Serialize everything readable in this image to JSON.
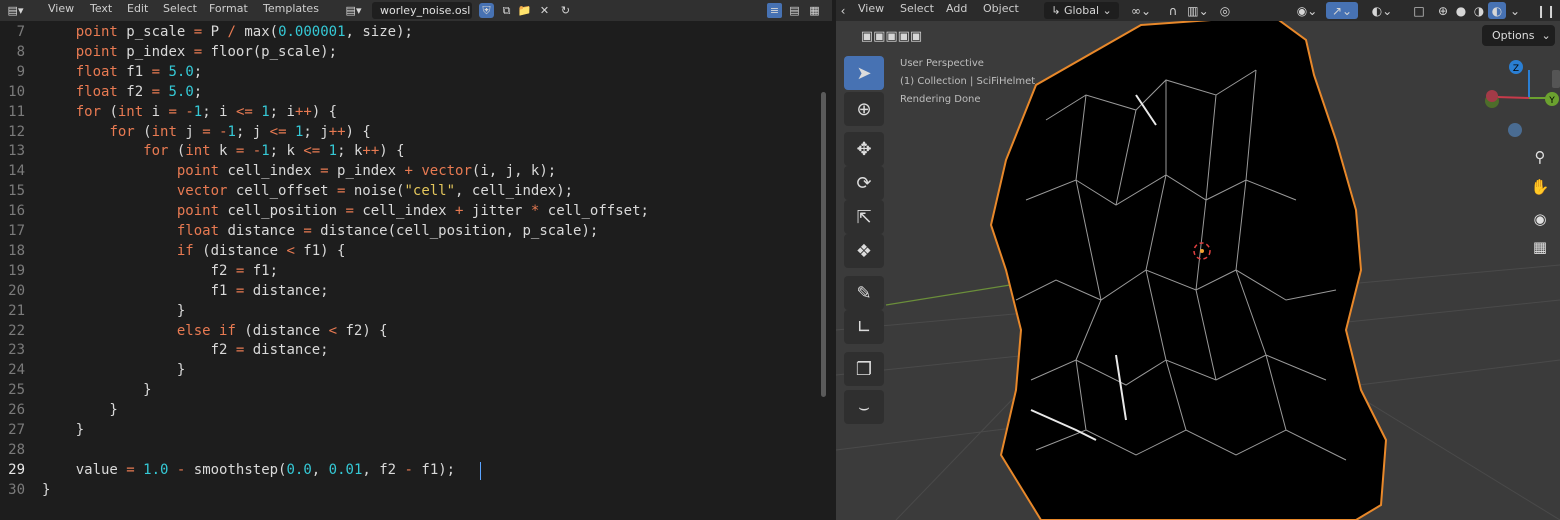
{
  "editor": {
    "menu": [
      "View",
      "Text",
      "Edit",
      "Select",
      "Format",
      "Templates"
    ],
    "filename": "worley_noise.osl",
    "current_line": 29,
    "lines": [
      {
        "n": 7,
        "code": "    point p_scale = P / max(0.000001, size);"
      },
      {
        "n": 8,
        "code": "    point p_index = floor(p_scale);"
      },
      {
        "n": 9,
        "code": "    float f1 = 5.0;"
      },
      {
        "n": 10,
        "code": "    float f2 = 5.0;"
      },
      {
        "n": 11,
        "code": "    for (int i = -1; i <= 1; i++) {"
      },
      {
        "n": 12,
        "code": "        for (int j = -1; j <= 1; j++) {"
      },
      {
        "n": 13,
        "code": "            for (int k = -1; k <= 1; k++) {"
      },
      {
        "n": 14,
        "code": "                point cell_index = p_index + vector(i, j, k);"
      },
      {
        "n": 15,
        "code": "                vector cell_offset = noise(\"cell\", cell_index);"
      },
      {
        "n": 16,
        "code": "                point cell_position = cell_index + jitter * cell_offset;"
      },
      {
        "n": 17,
        "code": "                float distance = distance(cell_position, p_scale);"
      },
      {
        "n": 18,
        "code": "                if (distance < f1) {"
      },
      {
        "n": 19,
        "code": "                    f2 = f1;"
      },
      {
        "n": 20,
        "code": "                    f1 = distance;"
      },
      {
        "n": 21,
        "code": "                }"
      },
      {
        "n": 22,
        "code": "                else if (distance < f2) {"
      },
      {
        "n": 23,
        "code": "                    f2 = distance;"
      },
      {
        "n": 24,
        "code": "                }"
      },
      {
        "n": 25,
        "code": "            }"
      },
      {
        "n": 26,
        "code": "        }"
      },
      {
        "n": 27,
        "code": "    }"
      },
      {
        "n": 28,
        "code": ""
      },
      {
        "n": 29,
        "code": "    value = 1.0 - smoothstep(0.0, 0.01, f2 - f1);"
      },
      {
        "n": 30,
        "code": "}"
      }
    ]
  },
  "viewport": {
    "menu": [
      "View",
      "Select",
      "Add",
      "Object"
    ],
    "orientation": "Global",
    "options_label": "Options",
    "overlay": [
      "User Perspective",
      "(1) Collection | SciFiHelmet",
      "Rendering Done"
    ],
    "gizmo_labels": {
      "z": "Z",
      "y": "Y"
    },
    "selection_outline_color": "#e8882a",
    "active_tool_color": "#4772b3"
  }
}
